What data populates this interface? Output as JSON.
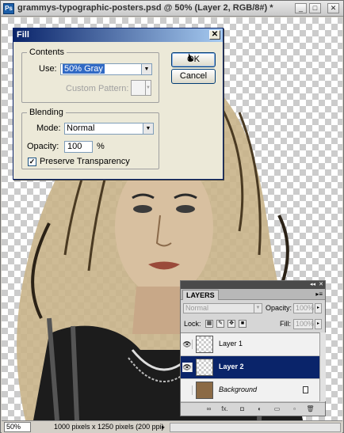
{
  "document": {
    "title": "grammys-typographic-posters.psd @ 50% (Layer 2, RGB/8#) *",
    "app_icon_label": "Ps",
    "minimize": "_",
    "maximize": "□",
    "close": "✕",
    "zoom": "50%",
    "status": "1000 pixels x 1250 pixels (200 ppi)"
  },
  "fill_dialog": {
    "title": "Fill",
    "close": "✕",
    "contents_label": "Contents",
    "use_label": "Use:",
    "use_value": "50% Gray",
    "custom_pattern_label": "Custom Pattern:",
    "blending_label": "Blending",
    "mode_label": "Mode:",
    "mode_value": "Normal",
    "opacity_label": "Opacity:",
    "opacity_value": "100",
    "opacity_unit": "%",
    "preserve_label": "Preserve Transparency",
    "preserve_checked": "✓",
    "ok_label": "OK",
    "cancel_label": "Cancel"
  },
  "layers_panel": {
    "tab": "LAYERS",
    "collapse": "◂◂",
    "close": "✕",
    "menu": "▸≡",
    "blend_mode": "Normal",
    "opacity_label": "Opacity:",
    "opacity_value": "100%",
    "lock_label": "Lock:",
    "fill_label": "Fill:",
    "fill_value": "100%",
    "layers": [
      {
        "name": "Layer 1",
        "visible": "👁",
        "selected": false
      },
      {
        "name": "Layer 2",
        "visible": "👁",
        "selected": true
      },
      {
        "name": "Background",
        "visible": "",
        "selected": false
      }
    ],
    "footer_icons": [
      "link-icon",
      "fx-icon",
      "mask-icon",
      "adjustment-icon",
      "group-icon",
      "new-layer-icon",
      "trash-icon"
    ],
    "footer_glyphs": [
      "∞",
      "fx.",
      "◘",
      "◐",
      "▭",
      "▫",
      "🗑"
    ]
  }
}
